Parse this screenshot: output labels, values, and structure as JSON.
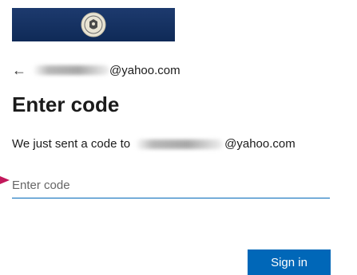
{
  "header": {
    "logo_icon": "university-seal-icon",
    "colors": {
      "banner": "#1d3a6e",
      "accent": "#0067b8",
      "pointer": "#c2185b"
    }
  },
  "identity": {
    "back_icon": "←",
    "email_domain": "@yahoo.com"
  },
  "page": {
    "title": "Enter code",
    "sent_prefix": "We just sent a code to",
    "sent_domain": "@yahoo.com"
  },
  "form": {
    "code_placeholder": "Enter code",
    "code_value": ""
  },
  "actions": {
    "signin_label": "Sign in"
  }
}
